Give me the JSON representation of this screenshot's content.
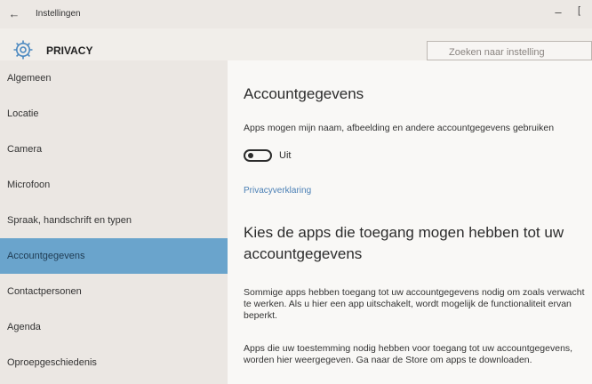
{
  "window": {
    "title": "Instellingen",
    "back_glyph": "←",
    "minimize_glyph": "–",
    "maximize_glyph": "[",
    "back_icon": "back-arrow-icon"
  },
  "header": {
    "section_title": "PRIVACY",
    "section_icon": "gear-icon",
    "search_placeholder": "Zoeken naar instelling"
  },
  "sidebar": {
    "active_color": "#6aa4cc",
    "items": [
      {
        "label": "Algemeen"
      },
      {
        "label": "Locatie"
      },
      {
        "label": "Camera"
      },
      {
        "label": "Microfoon"
      },
      {
        "label": "Spraak, handschrift en typen"
      },
      {
        "label": "Accountgegevens",
        "active": true
      },
      {
        "label": "Contactpersonen"
      },
      {
        "label": "Agenda"
      },
      {
        "label": "Oproepgeschiedenis"
      }
    ]
  },
  "main": {
    "title": "Accountgegevens",
    "setting_description": "Apps mogen mijn naam, afbeelding en andere accountgegevens gebruiken",
    "toggle_state": "Uit",
    "privacy_link": "Privacyverklaring",
    "subtitle": "Kies de apps die toegang mogen hebben tot uw accountgegevens",
    "paragraph1": "Sommige apps hebben toegang tot uw accountgegevens nodig om zoals verwacht te werken. Als u hier een app uitschakelt, wordt mogelijk de functionaliteit ervan beperkt.",
    "paragraph2": "Apps die uw toestemming nodig hebben voor toegang tot uw accountgegevens, worden hier weergegeven. Ga naar de Store om apps te downloaden."
  }
}
